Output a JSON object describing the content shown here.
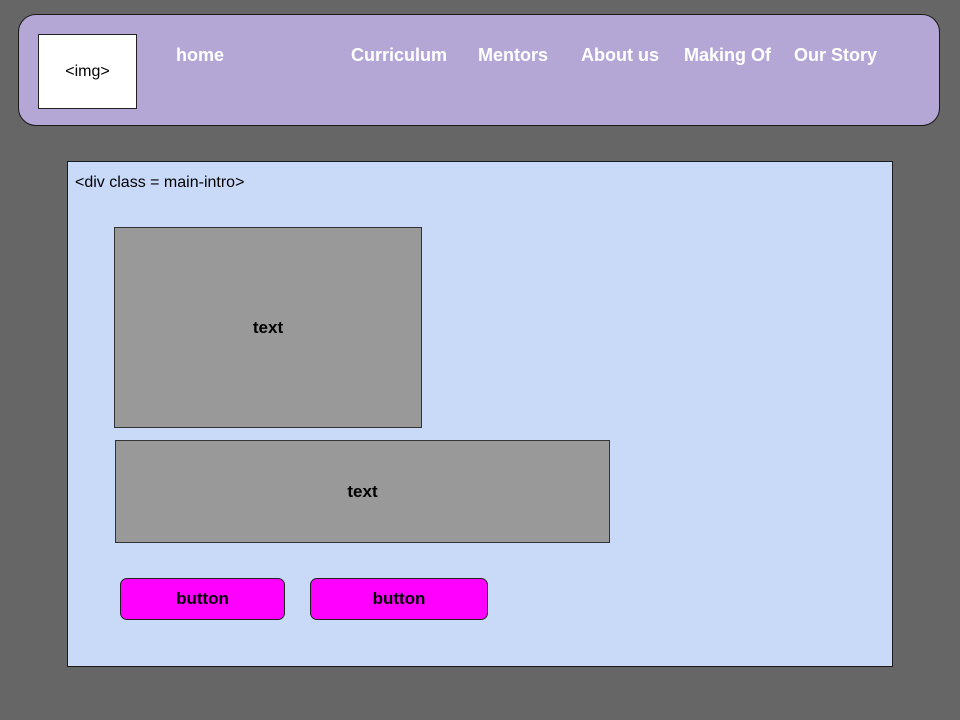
{
  "header": {
    "logo_text": "<img>",
    "nav": {
      "home": "home",
      "curriculum": "Curriculum",
      "mentors": "Mentors",
      "about_us": "About us",
      "making_of": "Making Of",
      "our_story": "Our Story"
    }
  },
  "main_intro": {
    "label": "<div class = main-intro>",
    "text_box_1": "text",
    "text_box_2": "text",
    "button_1": "button",
    "button_2": "button"
  },
  "colors": {
    "page_background": "#666666",
    "header_background": "#b4a7d6",
    "main_intro_background": "#c9daf8",
    "text_box_background": "#999999",
    "button_background": "#ff00ff",
    "nav_text": "#ffffff"
  }
}
